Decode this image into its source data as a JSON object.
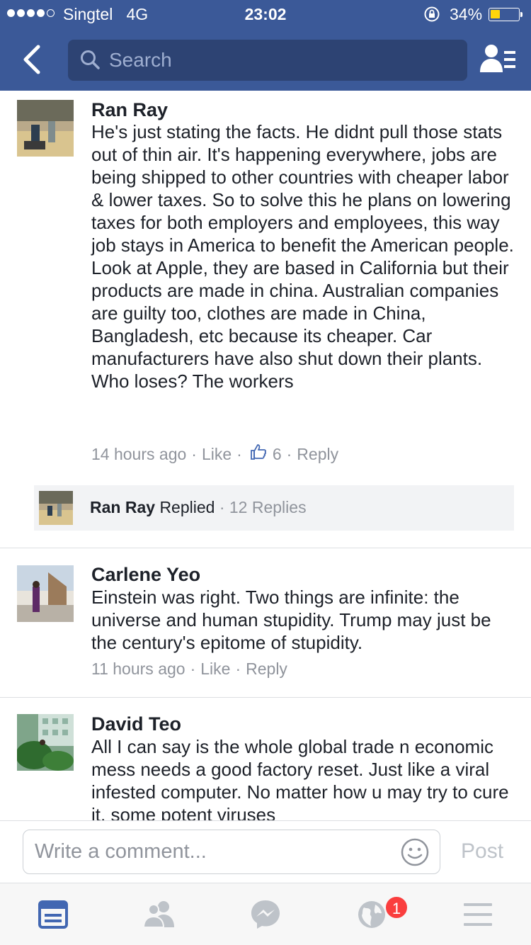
{
  "status_bar": {
    "carrier": "Singtel",
    "network": "4G",
    "time": "23:02",
    "battery_percent": "34%",
    "battery_level": 0.34,
    "signal_bars": 4
  },
  "header": {
    "search_placeholder": "Search",
    "back_icon": "chevron-left-icon",
    "friends_icon": "friend-requests-icon"
  },
  "comments": [
    {
      "author": "Ran Ray",
      "text": "He's just stating the facts. He didnt pull those stats out of thin air. It's happening everywhere, jobs are being shipped to other countries with cheaper labor & lower taxes. So to solve this he plans on lowering taxes for both employers and employees, this way job stays in America to benefit the American people. Look at Apple, they are based in California but their products are made in china. Australian companies are guilty too, clothes are made in China, Bangladesh, etc because its cheaper. Car manufacturers have also shut down their plants. Who loses? The workers",
      "time": "14 hours ago",
      "like_label": "Like",
      "like_count": "6",
      "reply_label": "Reply",
      "replies": {
        "author": "Ran Ray",
        "action": "Replied",
        "count_label": "12 Replies"
      }
    },
    {
      "author": "Carlene Yeo",
      "text": "Einstein was right. Two things are infinite: the universe and human stupidity. Trump may just be the century's epitome of stupidity.",
      "time": "11 hours ago",
      "like_label": "Like",
      "reply_label": "Reply"
    },
    {
      "author": "David Teo",
      "text": "All I can say is the whole global trade n economic mess needs a good factory reset. Just like a viral infested computer. No matter how u may try to cure it, some potent viruses"
    }
  ],
  "composer": {
    "placeholder": "Write a comment...",
    "post_label": "Post"
  },
  "tabbar": {
    "tabs": [
      "news-feed-icon",
      "friends-icon",
      "messenger-icon",
      "notifications-globe-icon",
      "menu-icon"
    ],
    "notification_badge": "1",
    "active_color": "#4267b2",
    "inactive_color": "#bec3c9"
  },
  "colors": {
    "brand": "#3b5998",
    "text": "#1d2129",
    "meta": "#90949c"
  }
}
